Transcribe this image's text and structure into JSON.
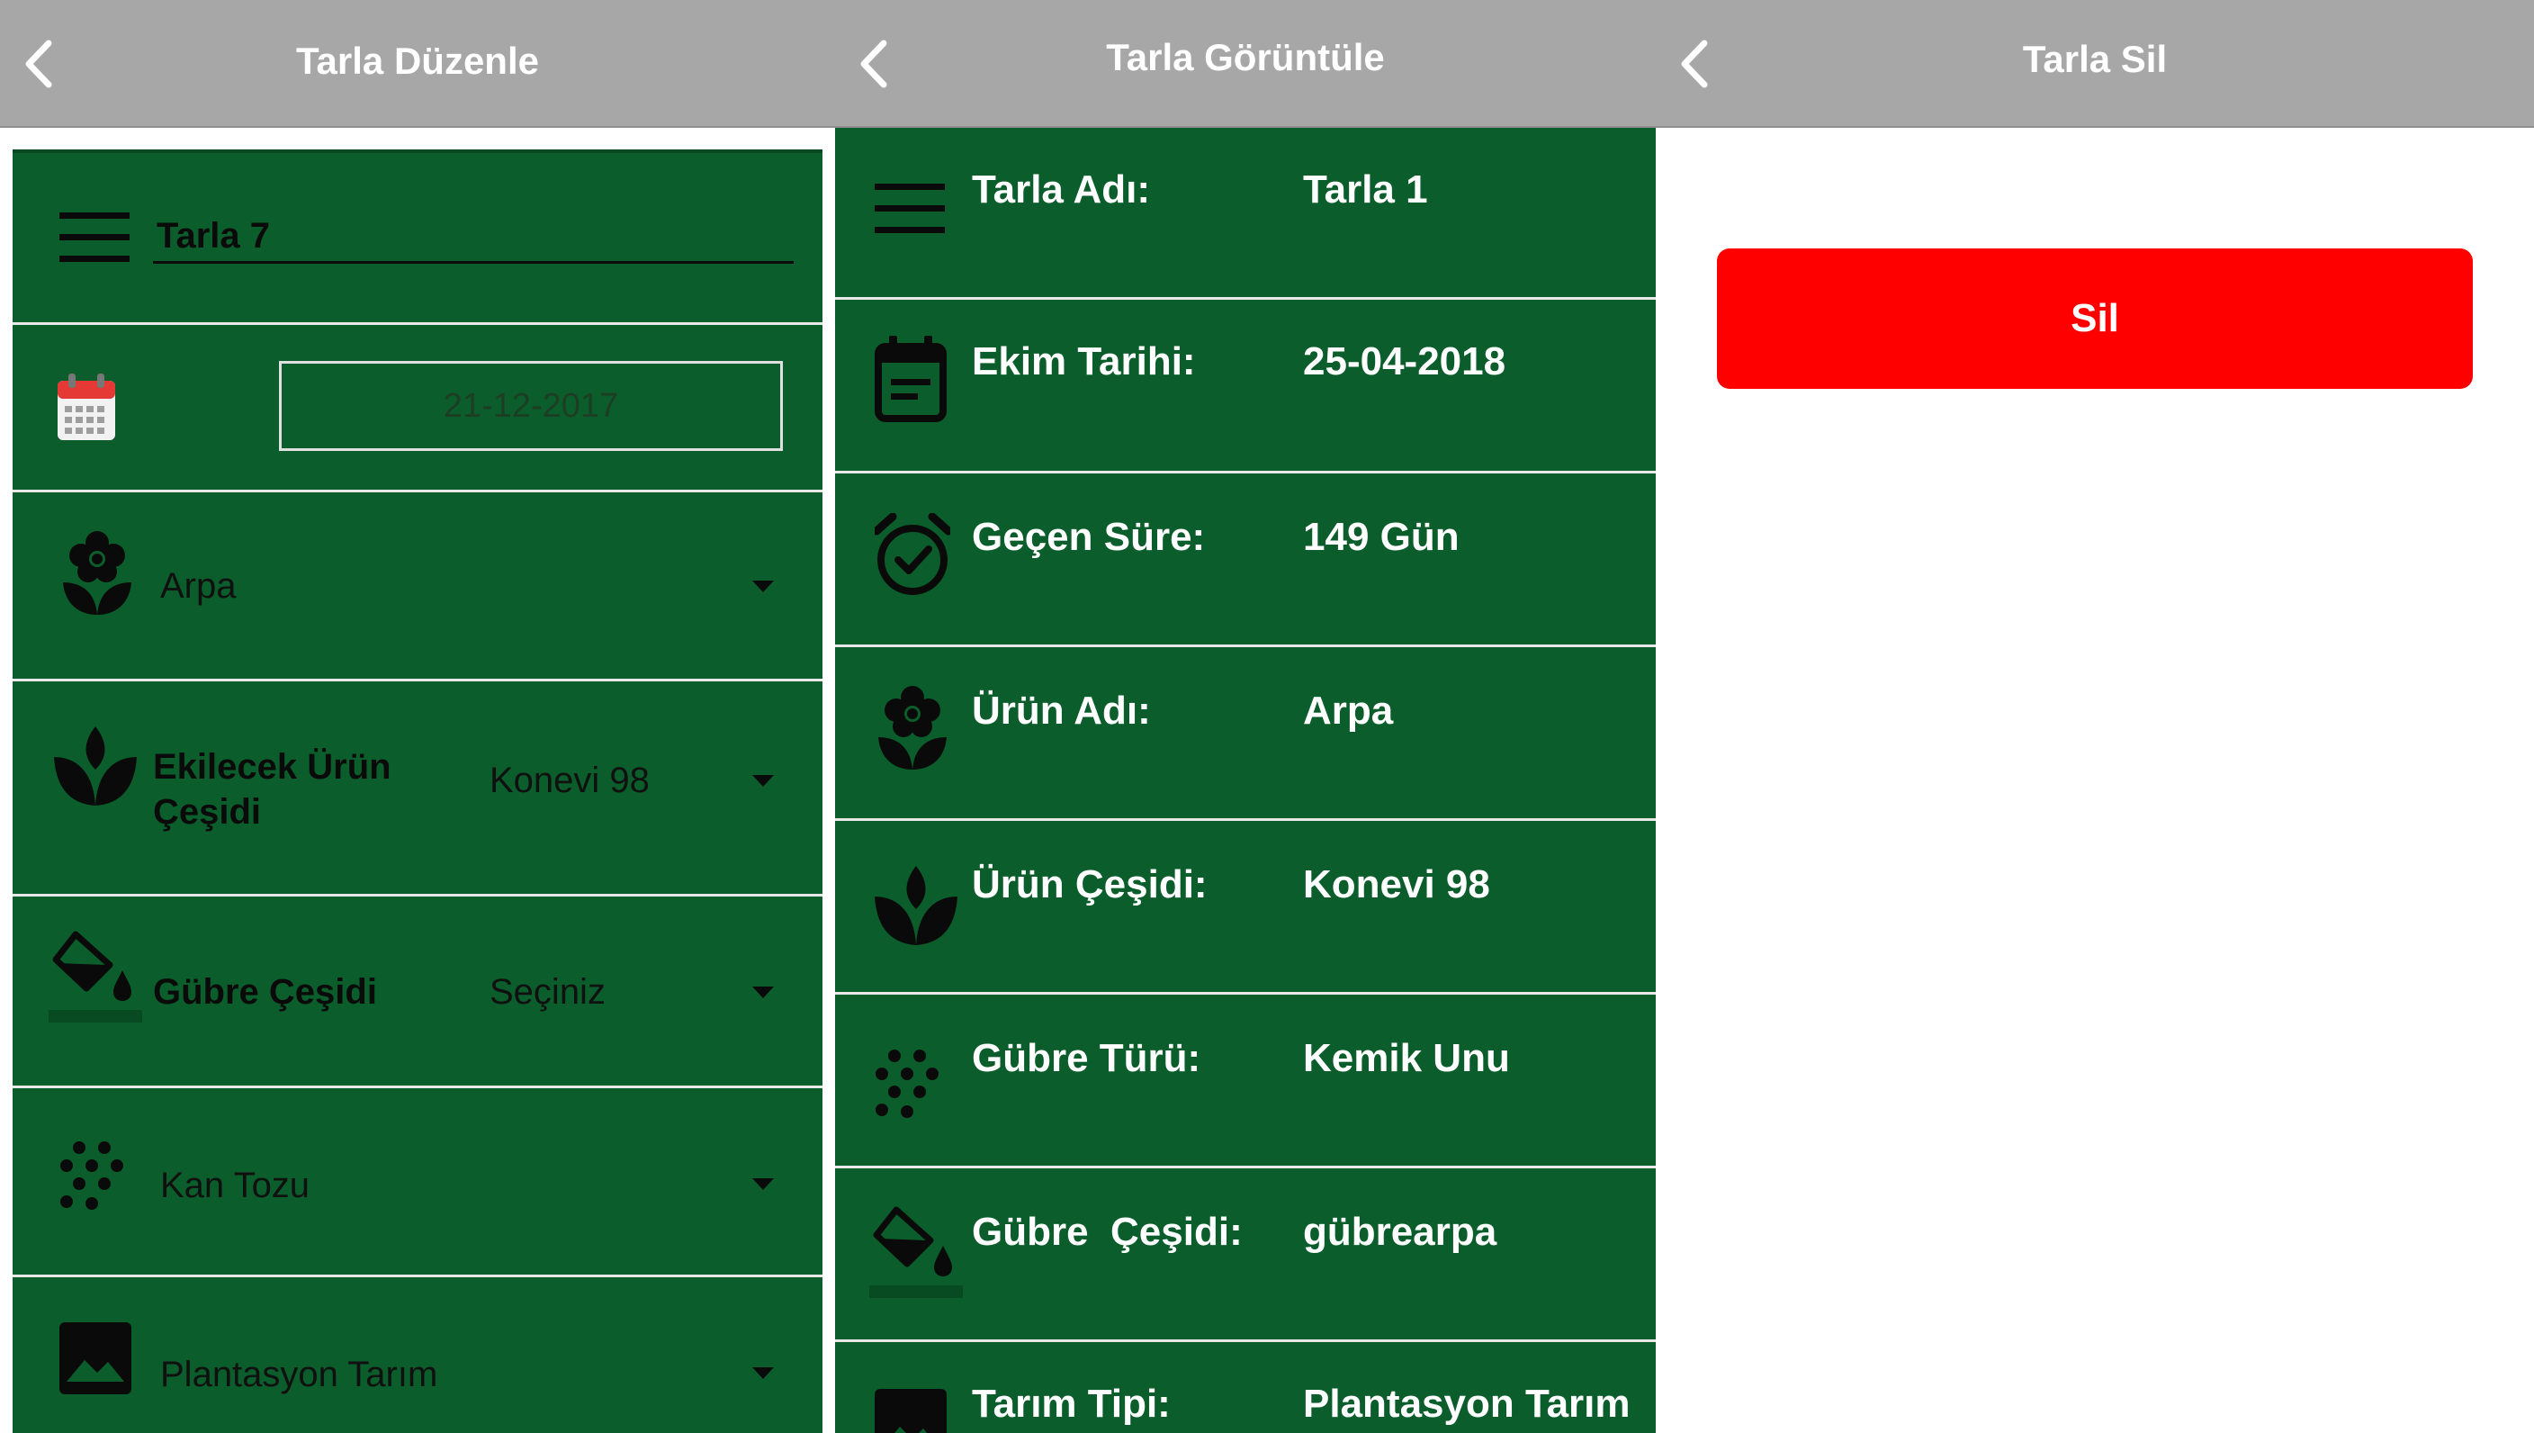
{
  "edit_screen": {
    "title": "Tarla Düzenle",
    "name_value": "Tarla 7",
    "date_value": "21-12-2017",
    "crop_value": "Arpa",
    "variety_label": "Ekilecek Ürün Çeşidi",
    "variety_value": "Konevi 98",
    "fertilizer_label": "Gübre Çeşidi",
    "fertilizer_value": "Seçiniz",
    "fertilizer_type_value": "Kan Tozu",
    "farming_type_value": "Plantasyon Tarım"
  },
  "view_screen": {
    "title": "Tarla Görüntüle",
    "rows": [
      {
        "label": "Tarla Adı:",
        "value": "Tarla 1",
        "icon": "menu-icon"
      },
      {
        "label": "Ekim Tarihi:",
        "value": "25-04-2018",
        "icon": "calendar-icon"
      },
      {
        "label": "Geçen Süre:",
        "value": "149 Gün",
        "icon": "alarm-check-icon"
      },
      {
        "label": "Ürün Adı:",
        "value": "Arpa",
        "icon": "flower-icon"
      },
      {
        "label": "Ürün Çeşidi:",
        "value": "Konevi 98",
        "icon": "sprout-icon"
      },
      {
        "label": "Gübre Türü:",
        "value": "Kemik Unu",
        "icon": "dots-icon"
      },
      {
        "label": "Gübre  Çeşidi:",
        "value": "gübrearpa",
        "icon": "paint-bucket-icon"
      },
      {
        "label": "Tarım Tipi:",
        "value": "Plantasyon Tarım",
        "icon": "image-icon"
      }
    ]
  },
  "delete_screen": {
    "title": "Tarla Sil",
    "delete_label": "Sil"
  },
  "colors": {
    "appbar": "#a7a7a7",
    "field_green": "#0b5e2b",
    "delete_red": "#ff0000"
  }
}
